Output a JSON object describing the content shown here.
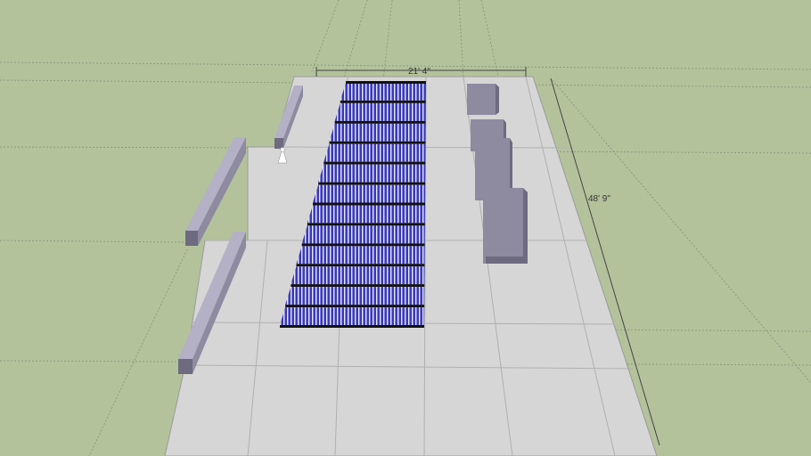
{
  "model_view": {
    "dimensions": {
      "width_label": "21' 4\"",
      "length_label": "48' 9\""
    },
    "colors": {
      "ground": "#b4c29c",
      "slab": "#d6d6d6",
      "slab_edge": "#9a9a9a",
      "panel": "#3a3ab8",
      "panel_stripe": "#e8e8f8",
      "panel_frame": "#111111",
      "box_front": "#8e8aa0",
      "box_top": "#b4b0c6",
      "box_side": "#6e6a80",
      "guide_line": "#8c9a7c"
    },
    "solar_panel_rows": 12,
    "equipment_boxes": 4,
    "icons": [
      "person-figure-icon"
    ]
  }
}
